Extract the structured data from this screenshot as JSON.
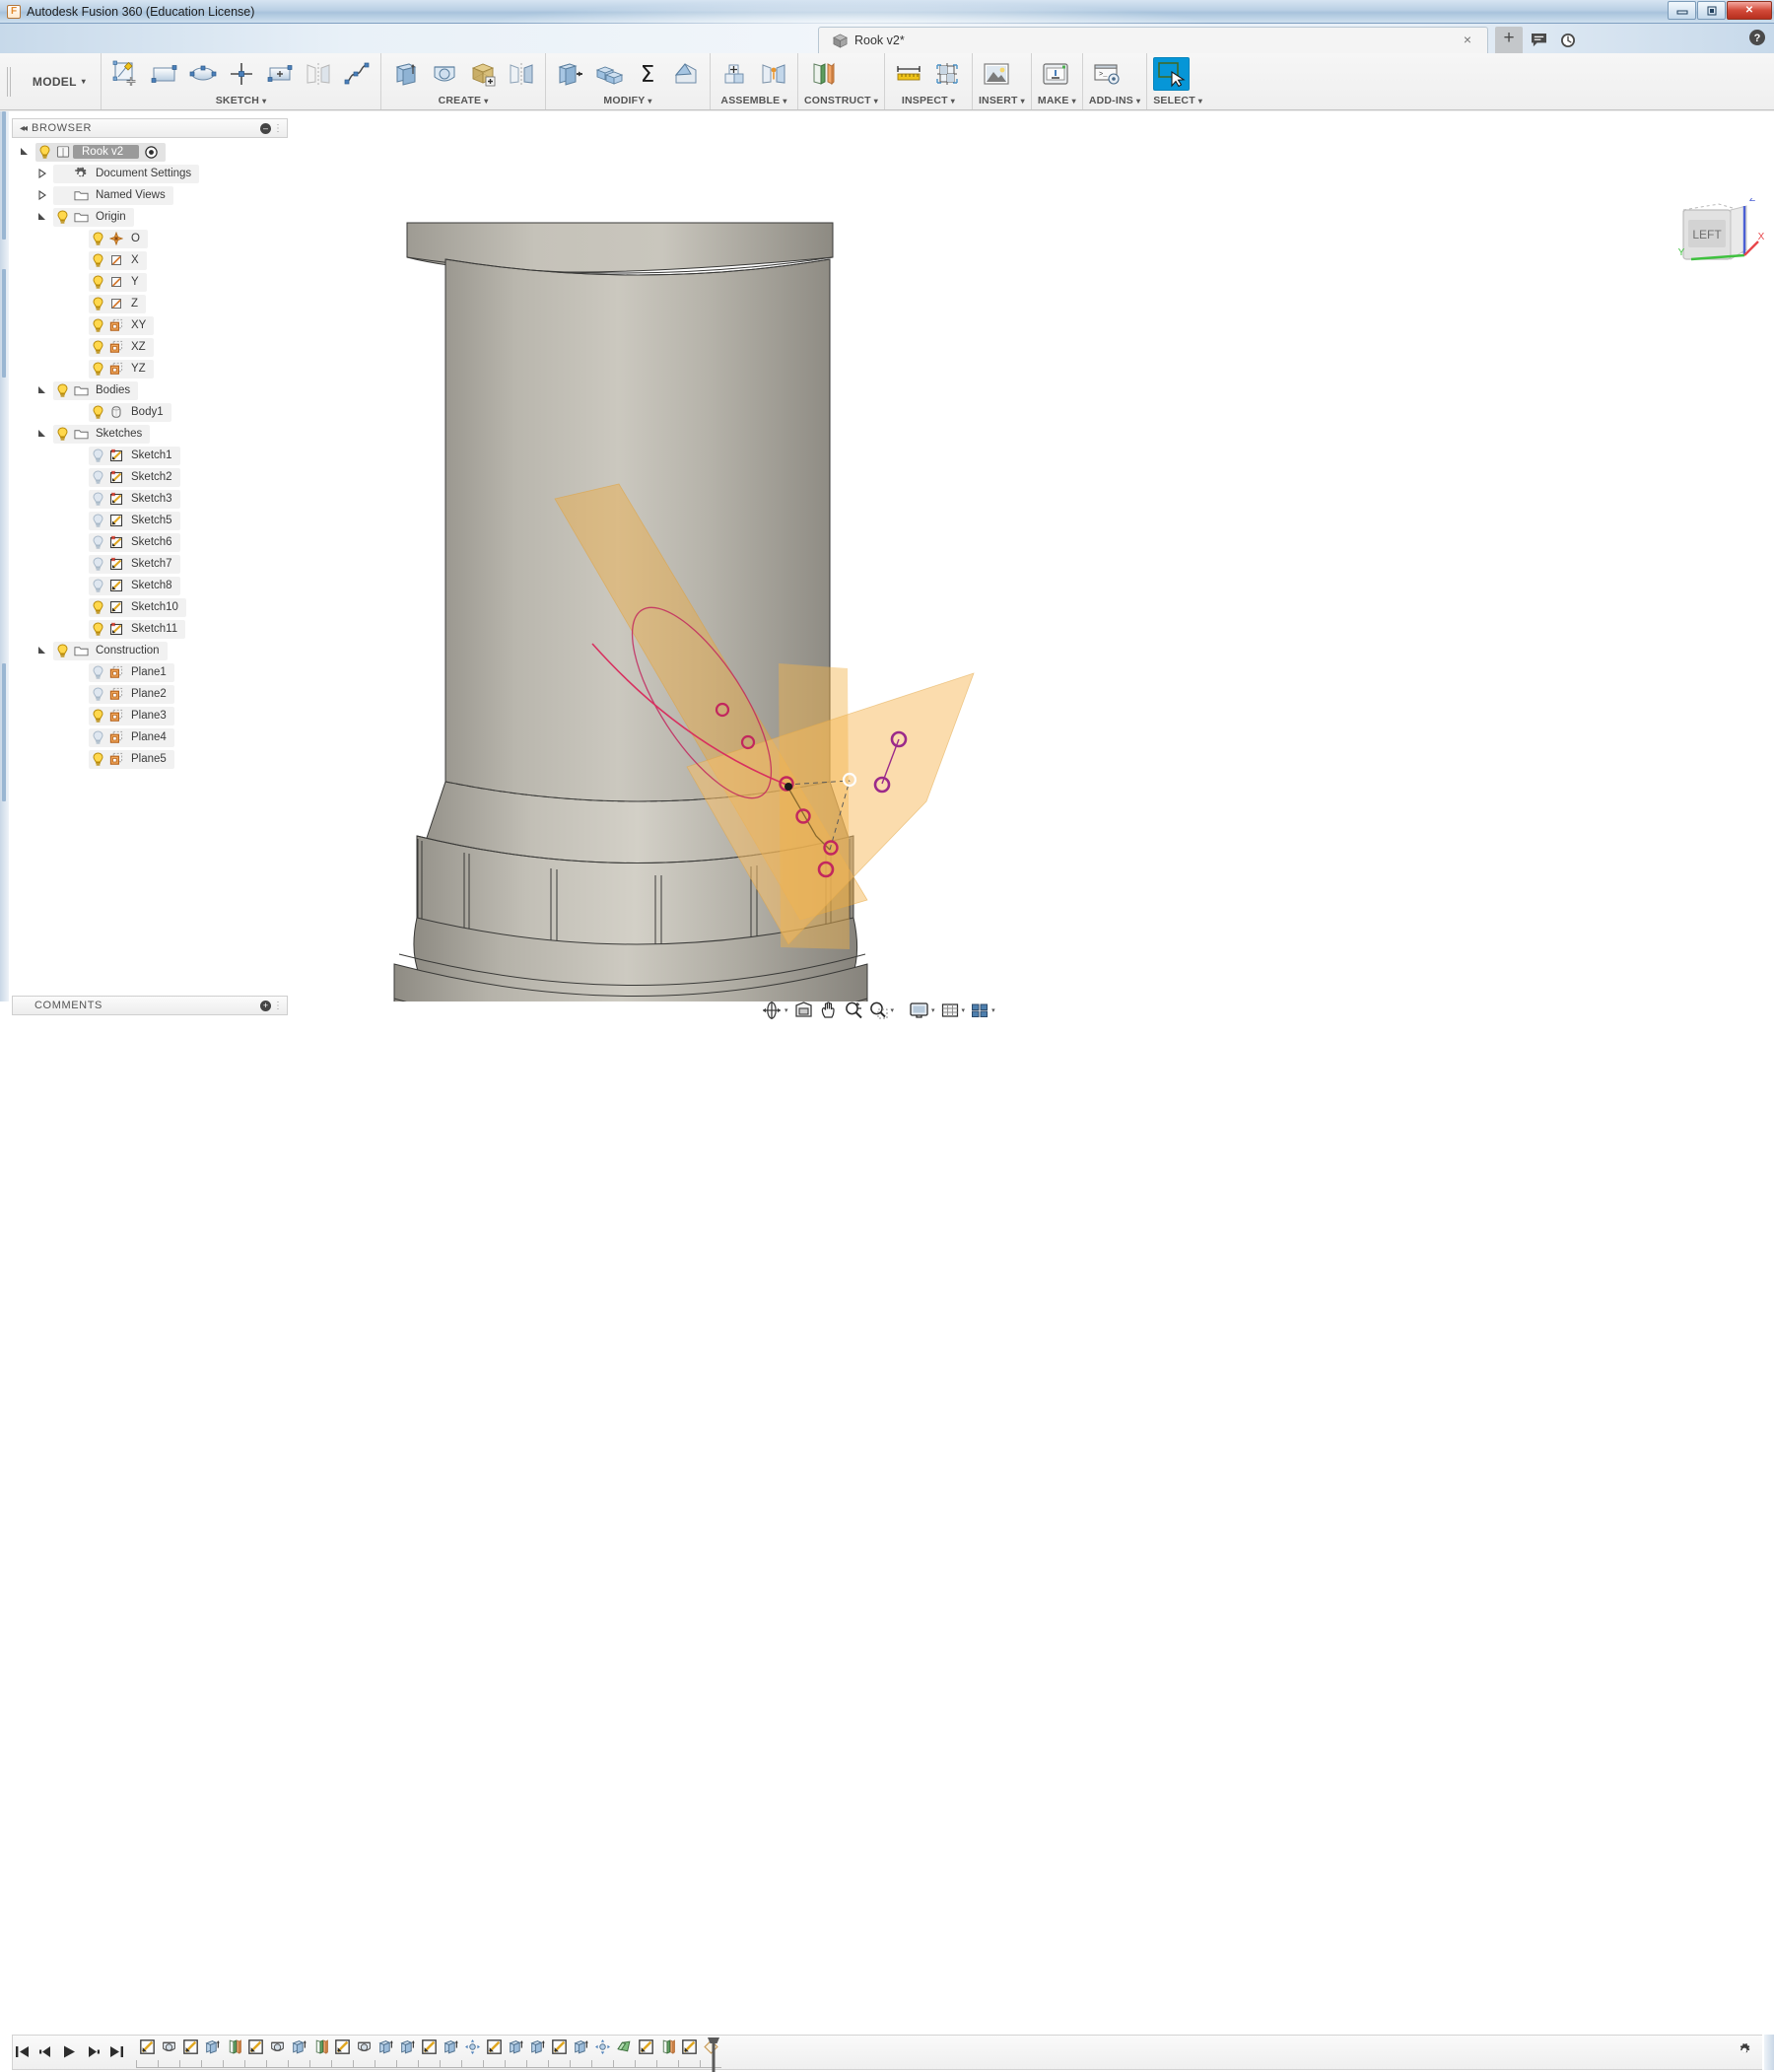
{
  "window": {
    "title": "Autodesk Fusion 360 (Education License)",
    "app_icon": "F",
    "minimize_label": "–",
    "maximize_label": "❐",
    "close_label": "✕"
  },
  "quick_access": {
    "items": [
      {
        "name": "grid-apps-icon",
        "label": ""
      },
      {
        "name": "new-file-icon",
        "label": ""
      },
      {
        "name": "save-icon",
        "label": ""
      },
      {
        "name": "undo-icon",
        "label": ""
      },
      {
        "name": "redo-icon",
        "label": ""
      }
    ]
  },
  "document_tab": {
    "label": "Rook v2*",
    "close_label": "×",
    "icon": "cube-icon"
  },
  "tab_tools": [
    {
      "name": "new-tab-button",
      "label": "+"
    },
    {
      "name": "comments-panel-icon",
      "label": ""
    },
    {
      "name": "job-status-icon",
      "label": ""
    }
  ],
  "help_button": {
    "name": "help-icon",
    "label": "?"
  },
  "ribbon": {
    "workspace": {
      "label": "MODEL",
      "caret": "▾"
    },
    "panels": [
      {
        "title": "SKETCH",
        "caret": "▾",
        "buttons": [
          {
            "name": "create-sketch-button",
            "icon": "sketch-create-icon",
            "active": false
          },
          {
            "name": "rectangle-button",
            "icon": "rectangle-icon",
            "active": false
          },
          {
            "name": "ellipse-button",
            "icon": "ellipse-icon",
            "active": false
          },
          {
            "name": "sketch-dimension-button",
            "icon": "dimension-cross-icon",
            "active": false
          },
          {
            "name": "rectangular-pattern-button",
            "icon": "rect-plus-icon",
            "active": false
          },
          {
            "name": "mirror-sketch-button",
            "icon": "mirror-sketch-icon",
            "active": false
          },
          {
            "name": "spline-button",
            "icon": "spline-icon",
            "active": false
          }
        ]
      },
      {
        "title": "CREATE",
        "caret": "▾",
        "buttons": [
          {
            "name": "extrude-button",
            "icon": "extrude-icon",
            "active": false
          },
          {
            "name": "revolve-button",
            "icon": "revolve-icon",
            "active": false
          },
          {
            "name": "box-button",
            "icon": "box-create-icon",
            "active": false
          },
          {
            "name": "mirror-body-button",
            "icon": "mirror-body-icon",
            "active": false
          }
        ]
      },
      {
        "title": "MODIFY",
        "caret": "▾",
        "buttons": [
          {
            "name": "press-pull-button",
            "icon": "press-pull-icon",
            "active": false
          },
          {
            "name": "combine-button",
            "icon": "combine-icon",
            "active": false
          },
          {
            "name": "change-parameters-button",
            "icon": "sigma-icon",
            "active": false
          },
          {
            "name": "draft-button",
            "icon": "draft-icon",
            "active": false
          }
        ]
      },
      {
        "title": "ASSEMBLE",
        "caret": "▾",
        "buttons": [
          {
            "name": "new-component-button",
            "icon": "new-component-icon",
            "active": false
          },
          {
            "name": "joint-button",
            "icon": "joint-icon",
            "active": false
          }
        ]
      },
      {
        "title": "CONSTRUCT",
        "caret": "▾",
        "buttons": [
          {
            "name": "offset-plane-button",
            "icon": "offset-plane-icon",
            "active": false
          }
        ]
      },
      {
        "title": "INSPECT",
        "caret": "▾",
        "buttons": [
          {
            "name": "measure-button",
            "icon": "ruler-icon",
            "active": false
          },
          {
            "name": "section-analysis-button",
            "icon": "section-analysis-icon",
            "active": false
          }
        ]
      },
      {
        "title": "INSERT",
        "caret": "▾",
        "buttons": [
          {
            "name": "insert-image-button",
            "icon": "image-icon",
            "active": false
          }
        ]
      },
      {
        "title": "MAKE",
        "caret": "▾",
        "buttons": [
          {
            "name": "3d-print-button",
            "icon": "printer-icon",
            "active": false
          }
        ]
      },
      {
        "title": "ADD-INS",
        "caret": "▾",
        "buttons": [
          {
            "name": "scripts-and-addins-button",
            "icon": "console-gear-icon",
            "active": false
          }
        ]
      },
      {
        "title": "SELECT",
        "caret": "▾",
        "buttons": [
          {
            "name": "select-tool-button",
            "icon": "select-arrow-icon",
            "active": true
          }
        ]
      }
    ]
  },
  "browser": {
    "header": {
      "title": "BROWSER",
      "collapse": "◂◂",
      "menu_dot": "–"
    },
    "nodes": [
      {
        "label": "Rook v2",
        "indent": 0,
        "arrow": "expanded",
        "bulb": "on",
        "icon": "component-icon",
        "root": true,
        "selected": true,
        "trailing": "activate-icon"
      },
      {
        "label": "Document Settings",
        "indent": 1,
        "arrow": "collapsed",
        "bulb": "none",
        "icon": "gear-icon"
      },
      {
        "label": "Named Views",
        "indent": 1,
        "arrow": "collapsed",
        "bulb": "none",
        "icon": "folder-icon"
      },
      {
        "label": "Origin",
        "indent": 1,
        "arrow": "expanded",
        "bulb": "on",
        "icon": "folder-icon"
      },
      {
        "label": "O",
        "indent": 3,
        "arrow": "none",
        "bulb": "on",
        "icon": "origin-point-icon"
      },
      {
        "label": "X",
        "indent": 3,
        "arrow": "none",
        "bulb": "on",
        "icon": "axis-icon"
      },
      {
        "label": "Y",
        "indent": 3,
        "arrow": "none",
        "bulb": "on",
        "icon": "axis-icon"
      },
      {
        "label": "Z",
        "indent": 3,
        "arrow": "none",
        "bulb": "on",
        "icon": "axis-icon"
      },
      {
        "label": "XY",
        "indent": 3,
        "arrow": "none",
        "bulb": "on",
        "icon": "plane-icon"
      },
      {
        "label": "XZ",
        "indent": 3,
        "arrow": "none",
        "bulb": "on",
        "icon": "plane-icon"
      },
      {
        "label": "YZ",
        "indent": 3,
        "arrow": "none",
        "bulb": "on",
        "icon": "plane-icon"
      },
      {
        "label": "Bodies",
        "indent": 1,
        "arrow": "expanded",
        "bulb": "on",
        "icon": "folder-icon"
      },
      {
        "label": "Body1",
        "indent": 3,
        "arrow": "none",
        "bulb": "on",
        "icon": "body-icon"
      },
      {
        "label": "Sketches",
        "indent": 1,
        "arrow": "expanded",
        "bulb": "on",
        "icon": "folder-icon"
      },
      {
        "label": "Sketch1",
        "indent": 3,
        "arrow": "none",
        "bulb": "off",
        "icon": "sketch-constrained-icon"
      },
      {
        "label": "Sketch2",
        "indent": 3,
        "arrow": "none",
        "bulb": "off",
        "icon": "sketch-constrained-icon"
      },
      {
        "label": "Sketch3",
        "indent": 3,
        "arrow": "none",
        "bulb": "off",
        "icon": "sketch-constrained-icon"
      },
      {
        "label": "Sketch5",
        "indent": 3,
        "arrow": "none",
        "bulb": "off",
        "icon": "sketch-icon"
      },
      {
        "label": "Sketch6",
        "indent": 3,
        "arrow": "none",
        "bulb": "off",
        "icon": "sketch-constrained-icon"
      },
      {
        "label": "Sketch7",
        "indent": 3,
        "arrow": "none",
        "bulb": "off",
        "icon": "sketch-constrained-icon"
      },
      {
        "label": "Sketch8",
        "indent": 3,
        "arrow": "none",
        "bulb": "off",
        "icon": "sketch-icon"
      },
      {
        "label": "Sketch10",
        "indent": 3,
        "arrow": "none",
        "bulb": "on",
        "icon": "sketch-icon"
      },
      {
        "label": "Sketch11",
        "indent": 3,
        "arrow": "none",
        "bulb": "on",
        "icon": "sketch-constrained-icon"
      },
      {
        "label": "Construction",
        "indent": 1,
        "arrow": "expanded",
        "bulb": "on",
        "icon": "folder-icon"
      },
      {
        "label": "Plane1",
        "indent": 3,
        "arrow": "none",
        "bulb": "off",
        "icon": "plane-icon"
      },
      {
        "label": "Plane2",
        "indent": 3,
        "arrow": "none",
        "bulb": "off",
        "icon": "plane-icon"
      },
      {
        "label": "Plane3",
        "indent": 3,
        "arrow": "none",
        "bulb": "on",
        "icon": "plane-icon"
      },
      {
        "label": "Plane4",
        "indent": 3,
        "arrow": "none",
        "bulb": "off",
        "icon": "plane-icon"
      },
      {
        "label": "Plane5",
        "indent": 3,
        "arrow": "none",
        "bulb": "on",
        "icon": "plane-icon"
      }
    ]
  },
  "comments": {
    "title": "COMMENTS",
    "menu_dot": "+"
  },
  "viewcube": {
    "face_label": "LEFT",
    "axis_x": "X",
    "axis_y": "Y",
    "axis_z": "Z",
    "axis_x_color": "#e8474b",
    "axis_y_color": "#3fc13f",
    "axis_z_color": "#4a5fd4"
  },
  "navbar": {
    "buttons": [
      {
        "name": "orbit-button",
        "icon": "orbit-icon",
        "caret": "▾"
      },
      {
        "name": "look-at-button",
        "icon": "look-at-icon",
        "caret": ""
      },
      {
        "name": "pan-button",
        "icon": "hand-icon",
        "caret": ""
      },
      {
        "name": "zoom-button",
        "icon": "zoom-icon",
        "caret": ""
      },
      {
        "name": "zoom-window-button",
        "icon": "zoom-window-icon",
        "caret": "▾"
      },
      {
        "name": "display-settings-button",
        "icon": "display-settings-icon",
        "caret": "▾"
      },
      {
        "name": "grid-snaps-button",
        "icon": "grid-snaps-icon",
        "caret": "▾"
      },
      {
        "name": "viewports-button",
        "icon": "viewports-icon",
        "caret": "▾"
      }
    ]
  },
  "timeline": {
    "playback": [
      {
        "name": "go-to-beginning-button",
        "icon": "skip-start-icon"
      },
      {
        "name": "step-back-button",
        "icon": "step-back-icon"
      },
      {
        "name": "play-button",
        "icon": "play-icon"
      },
      {
        "name": "step-forward-button",
        "icon": "step-forward-icon"
      },
      {
        "name": "go-to-end-button",
        "icon": "skip-end-icon"
      }
    ],
    "features": [
      {
        "name": "timeline-sketch",
        "icon": "sketch-icon"
      },
      {
        "name": "timeline-revolve",
        "icon": "revolve-icon"
      },
      {
        "name": "timeline-sketch",
        "icon": "sketch-icon"
      },
      {
        "name": "timeline-extrude",
        "icon": "extrude-icon"
      },
      {
        "name": "timeline-plane",
        "icon": "plane-icon"
      },
      {
        "name": "timeline-sketch",
        "icon": "sketch-icon"
      },
      {
        "name": "timeline-revolve",
        "icon": "revolve-icon"
      },
      {
        "name": "timeline-extrude",
        "icon": "extrude-icon"
      },
      {
        "name": "timeline-plane",
        "icon": "plane-icon"
      },
      {
        "name": "timeline-sketch",
        "icon": "sketch-icon"
      },
      {
        "name": "timeline-revolve",
        "icon": "revolve-icon"
      },
      {
        "name": "timeline-extrude",
        "icon": "extrude-icon"
      },
      {
        "name": "timeline-extrude",
        "icon": "extrude-icon"
      },
      {
        "name": "timeline-sketch",
        "icon": "sketch-icon"
      },
      {
        "name": "timeline-extrude",
        "icon": "extrude-icon"
      },
      {
        "name": "timeline-pattern",
        "icon": "pattern-icon"
      },
      {
        "name": "timeline-sketch",
        "icon": "sketch-icon"
      },
      {
        "name": "timeline-extrude",
        "icon": "extrude-icon"
      },
      {
        "name": "timeline-extrude",
        "icon": "extrude-icon"
      },
      {
        "name": "timeline-sketch",
        "icon": "sketch-icon"
      },
      {
        "name": "timeline-extrude",
        "icon": "extrude-icon"
      },
      {
        "name": "timeline-pattern",
        "icon": "pattern-icon"
      },
      {
        "name": "timeline-loft",
        "icon": "loft-icon"
      },
      {
        "name": "timeline-sketch",
        "icon": "sketch-icon"
      },
      {
        "name": "timeline-plane",
        "icon": "plane-icon"
      },
      {
        "name": "timeline-sketch",
        "icon": "sketch-icon"
      },
      {
        "name": "timeline-pending",
        "icon": "pending-icon"
      }
    ],
    "settings": {
      "name": "timeline-settings-gear",
      "icon": "gear-icon"
    }
  },
  "model": {
    "view_orientation": "LEFT",
    "body_color": "#b3b0a6",
    "plane_color": "#f4b942",
    "sketch_color": "#c2275e"
  }
}
